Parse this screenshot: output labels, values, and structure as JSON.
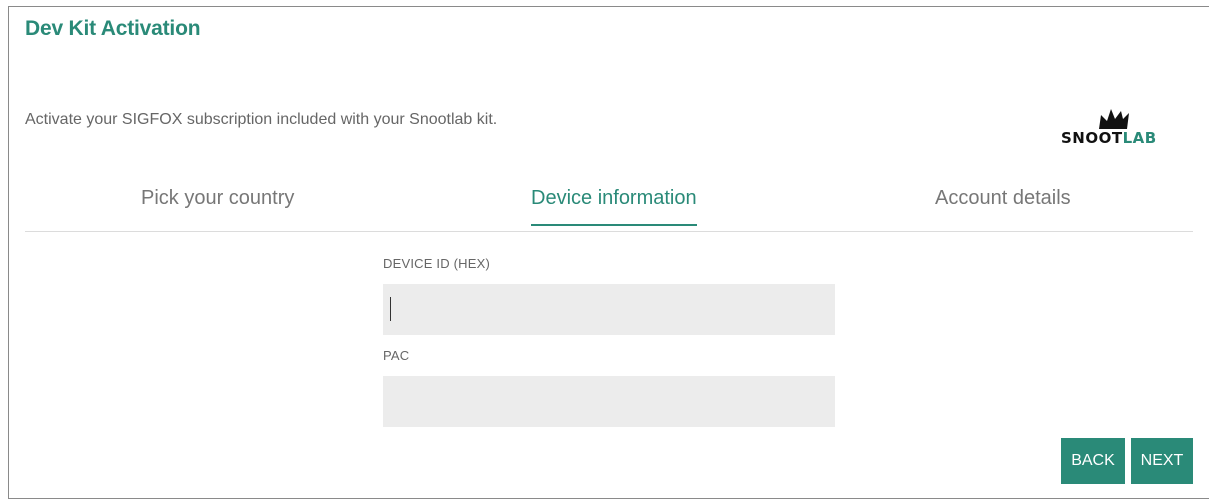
{
  "header": {
    "title": "Dev Kit Activation",
    "subtitle": "Activate your SIGFOX subscription included with your Snootlab kit."
  },
  "logo": {
    "part1": "SNOOT",
    "part2": "LAB",
    "colors": {
      "dark": "#111111",
      "accent": "#2a8a78"
    }
  },
  "tabs": [
    {
      "label": "Pick your country",
      "active": false
    },
    {
      "label": "Device information",
      "active": true
    },
    {
      "label": "Account details",
      "active": false
    }
  ],
  "form": {
    "device_id": {
      "label": "DEVICE ID (HEX)",
      "value": "",
      "placeholder": ""
    },
    "pac": {
      "label": "PAC",
      "value": "",
      "placeholder": ""
    }
  },
  "buttons": {
    "back": "BACK",
    "next": "NEXT"
  },
  "colors": {
    "accent": "#2a8a78",
    "input_bg": "#ececec",
    "muted_text": "#777777"
  }
}
